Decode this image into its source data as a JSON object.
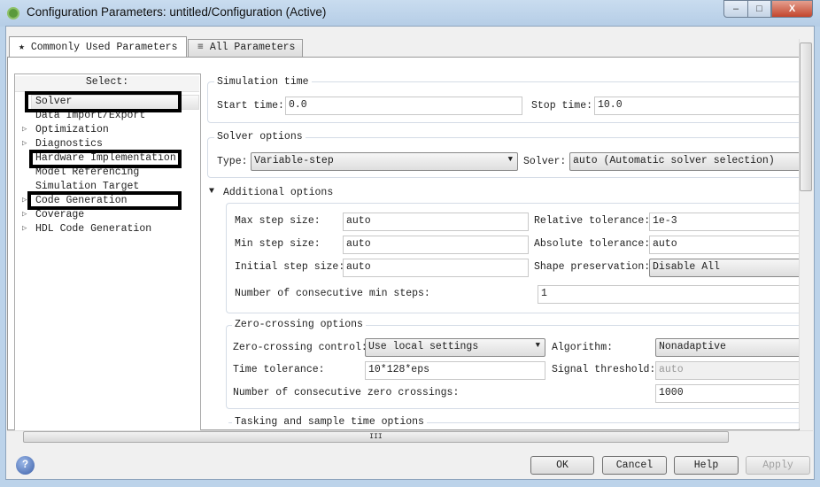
{
  "window": {
    "title": "Configuration Parameters: untitled/Configuration (Active)",
    "minimize": "–",
    "maximize": "□",
    "close": "X"
  },
  "tabs": [
    {
      "label": "Commonly Used Parameters",
      "icon": "star-icon",
      "glyph": "★"
    },
    {
      "label": "All Parameters",
      "icon": "list-icon",
      "glyph": "≡"
    }
  ],
  "tree": {
    "header": "Select:",
    "items": [
      {
        "label": "Solver",
        "expandable": false,
        "selected": true
      },
      {
        "label": "Data Import/Export",
        "expandable": false
      },
      {
        "label": "Optimization",
        "expandable": true
      },
      {
        "label": "Diagnostics",
        "expandable": true
      },
      {
        "label": "Hardware Implementation",
        "expandable": false
      },
      {
        "label": "Model Referencing",
        "expandable": false
      },
      {
        "label": "Simulation Target",
        "expandable": false
      },
      {
        "label": "Code Generation",
        "expandable": true
      },
      {
        "label": "Coverage",
        "expandable": true
      },
      {
        "label": "HDL Code Generation",
        "expandable": true
      }
    ]
  },
  "sim_time": {
    "title": "Simulation time",
    "start_label": "Start time:",
    "start_value": "0.0",
    "stop_label": "Stop time:",
    "stop_value": "10.0"
  },
  "solver_options": {
    "title": "Solver options",
    "type_label": "Type:",
    "type_value": "Variable-step",
    "solver_label": "Solver:",
    "solver_value": "auto (Automatic solver selection)"
  },
  "additional": {
    "title": "Additional options",
    "max_step_label": "Max step size:",
    "max_step_value": "auto",
    "rel_tol_label": "Relative tolerance:",
    "rel_tol_value": "1e-3",
    "min_step_label": "Min step size:",
    "min_step_value": "auto",
    "abs_tol_label": "Absolute tolerance:",
    "abs_tol_value": "auto",
    "init_step_label": "Initial step size:",
    "init_step_value": "auto",
    "shape_label": "Shape preservation:",
    "shape_value": "Disable All",
    "min_steps_label": "Number of consecutive min steps:",
    "min_steps_value": "1"
  },
  "zero_crossing": {
    "title": "Zero-crossing options",
    "control_label": "Zero-crossing control:",
    "control_value": "Use local settings",
    "algorithm_label": "Algorithm:",
    "algorithm_value": "Nonadaptive",
    "time_tol_label": "Time tolerance:",
    "time_tol_value": "10*128*eps",
    "signal_label": "Signal threshold:",
    "signal_value": "auto",
    "consec_label": "Number of consecutive zero crossings:",
    "consec_value": "1000"
  },
  "tasking": {
    "title": "Tasking and sample time options"
  },
  "buttons": {
    "ok": "OK",
    "cancel": "Cancel",
    "help": "Help",
    "apply": "Apply",
    "help_icon": "?"
  }
}
